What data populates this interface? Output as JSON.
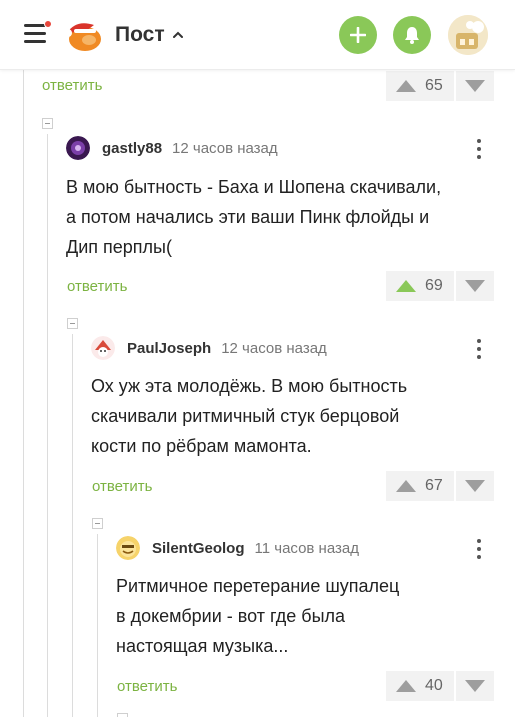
{
  "header": {
    "title": "Пост",
    "notification_dot_color": "#e8473c",
    "accent_color": "#8ac858",
    "icons": [
      "burger-menu-icon",
      "pikabu-logo-icon",
      "chevron-up-icon",
      "plus-icon",
      "bell-icon",
      "user-avatar"
    ]
  },
  "comments": [
    {
      "reply": "ответить",
      "score": "65"
    },
    {
      "author": "gastly88",
      "time": "12 часов назад",
      "lines": [
        "В мою бытность - Баха и Шопена скачивали,",
        "а потом начались эти ваши Пинк флойды и",
        "Дип перплы("
      ],
      "reply": "ответить",
      "score": "69",
      "upvoted": true
    },
    {
      "author": "PaulJoseph",
      "time": "12 часов назад",
      "lines": [
        "Ох уж эта молодёжь. В мою бытность",
        "скачивали ритмичный стук берцовой",
        "кости по рёбрам мамонта."
      ],
      "reply": "ответить",
      "score": "67"
    },
    {
      "author": "SilentGeolog",
      "time": "11 часов назад",
      "lines": [
        "Ритмичное перетерание шупалец",
        "в докембрии - вот где была",
        "настоящая музыка..."
      ],
      "reply": "ответить",
      "score": "40"
    }
  ],
  "colors": {
    "reply_link": "#7cb342",
    "upvote_active": "#8ac858",
    "vote_inactive": "#9e9e9e"
  }
}
